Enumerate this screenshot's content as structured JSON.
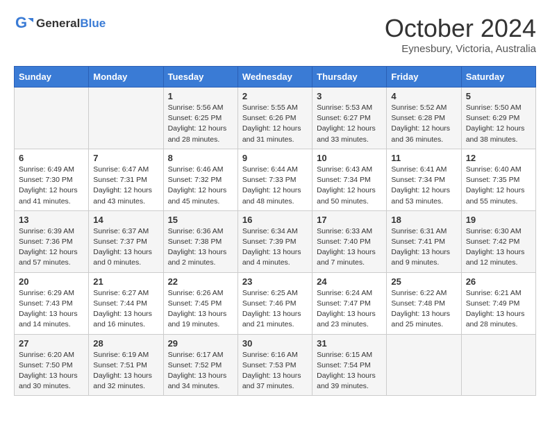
{
  "logo": {
    "general": "General",
    "blue": "Blue"
  },
  "title": "October 2024",
  "location": "Eynesbury, Victoria, Australia",
  "days_of_week": [
    "Sunday",
    "Monday",
    "Tuesday",
    "Wednesday",
    "Thursday",
    "Friday",
    "Saturday"
  ],
  "weeks": [
    [
      {
        "day": "",
        "info": ""
      },
      {
        "day": "",
        "info": ""
      },
      {
        "day": "1",
        "info": "Sunrise: 5:56 AM\nSunset: 6:25 PM\nDaylight: 12 hours and 28 minutes."
      },
      {
        "day": "2",
        "info": "Sunrise: 5:55 AM\nSunset: 6:26 PM\nDaylight: 12 hours and 31 minutes."
      },
      {
        "day": "3",
        "info": "Sunrise: 5:53 AM\nSunset: 6:27 PM\nDaylight: 12 hours and 33 minutes."
      },
      {
        "day": "4",
        "info": "Sunrise: 5:52 AM\nSunset: 6:28 PM\nDaylight: 12 hours and 36 minutes."
      },
      {
        "day": "5",
        "info": "Sunrise: 5:50 AM\nSunset: 6:29 PM\nDaylight: 12 hours and 38 minutes."
      }
    ],
    [
      {
        "day": "6",
        "info": "Sunrise: 6:49 AM\nSunset: 7:30 PM\nDaylight: 12 hours and 41 minutes."
      },
      {
        "day": "7",
        "info": "Sunrise: 6:47 AM\nSunset: 7:31 PM\nDaylight: 12 hours and 43 minutes."
      },
      {
        "day": "8",
        "info": "Sunrise: 6:46 AM\nSunset: 7:32 PM\nDaylight: 12 hours and 45 minutes."
      },
      {
        "day": "9",
        "info": "Sunrise: 6:44 AM\nSunset: 7:33 PM\nDaylight: 12 hours and 48 minutes."
      },
      {
        "day": "10",
        "info": "Sunrise: 6:43 AM\nSunset: 7:34 PM\nDaylight: 12 hours and 50 minutes."
      },
      {
        "day": "11",
        "info": "Sunrise: 6:41 AM\nSunset: 7:34 PM\nDaylight: 12 hours and 53 minutes."
      },
      {
        "day": "12",
        "info": "Sunrise: 6:40 AM\nSunset: 7:35 PM\nDaylight: 12 hours and 55 minutes."
      }
    ],
    [
      {
        "day": "13",
        "info": "Sunrise: 6:39 AM\nSunset: 7:36 PM\nDaylight: 12 hours and 57 minutes."
      },
      {
        "day": "14",
        "info": "Sunrise: 6:37 AM\nSunset: 7:37 PM\nDaylight: 13 hours and 0 minutes."
      },
      {
        "day": "15",
        "info": "Sunrise: 6:36 AM\nSunset: 7:38 PM\nDaylight: 13 hours and 2 minutes."
      },
      {
        "day": "16",
        "info": "Sunrise: 6:34 AM\nSunset: 7:39 PM\nDaylight: 13 hours and 4 minutes."
      },
      {
        "day": "17",
        "info": "Sunrise: 6:33 AM\nSunset: 7:40 PM\nDaylight: 13 hours and 7 minutes."
      },
      {
        "day": "18",
        "info": "Sunrise: 6:31 AM\nSunset: 7:41 PM\nDaylight: 13 hours and 9 minutes."
      },
      {
        "day": "19",
        "info": "Sunrise: 6:30 AM\nSunset: 7:42 PM\nDaylight: 13 hours and 12 minutes."
      }
    ],
    [
      {
        "day": "20",
        "info": "Sunrise: 6:29 AM\nSunset: 7:43 PM\nDaylight: 13 hours and 14 minutes."
      },
      {
        "day": "21",
        "info": "Sunrise: 6:27 AM\nSunset: 7:44 PM\nDaylight: 13 hours and 16 minutes."
      },
      {
        "day": "22",
        "info": "Sunrise: 6:26 AM\nSunset: 7:45 PM\nDaylight: 13 hours and 19 minutes."
      },
      {
        "day": "23",
        "info": "Sunrise: 6:25 AM\nSunset: 7:46 PM\nDaylight: 13 hours and 21 minutes."
      },
      {
        "day": "24",
        "info": "Sunrise: 6:24 AM\nSunset: 7:47 PM\nDaylight: 13 hours and 23 minutes."
      },
      {
        "day": "25",
        "info": "Sunrise: 6:22 AM\nSunset: 7:48 PM\nDaylight: 13 hours and 25 minutes."
      },
      {
        "day": "26",
        "info": "Sunrise: 6:21 AM\nSunset: 7:49 PM\nDaylight: 13 hours and 28 minutes."
      }
    ],
    [
      {
        "day": "27",
        "info": "Sunrise: 6:20 AM\nSunset: 7:50 PM\nDaylight: 13 hours and 30 minutes."
      },
      {
        "day": "28",
        "info": "Sunrise: 6:19 AM\nSunset: 7:51 PM\nDaylight: 13 hours and 32 minutes."
      },
      {
        "day": "29",
        "info": "Sunrise: 6:17 AM\nSunset: 7:52 PM\nDaylight: 13 hours and 34 minutes."
      },
      {
        "day": "30",
        "info": "Sunrise: 6:16 AM\nSunset: 7:53 PM\nDaylight: 13 hours and 37 minutes."
      },
      {
        "day": "31",
        "info": "Sunrise: 6:15 AM\nSunset: 7:54 PM\nDaylight: 13 hours and 39 minutes."
      },
      {
        "day": "",
        "info": ""
      },
      {
        "day": "",
        "info": ""
      }
    ]
  ]
}
